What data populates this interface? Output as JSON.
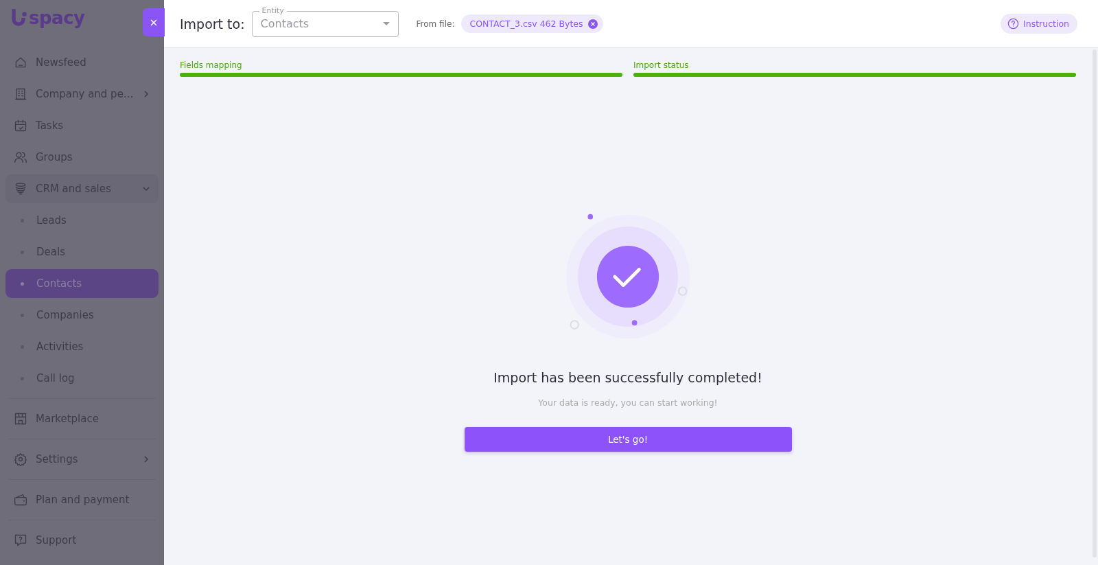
{
  "sidebar": {
    "logo": "spacy",
    "items": [
      {
        "kind": "item",
        "label": "Newsfeed",
        "submenu": false,
        "selected": false
      },
      {
        "kind": "item",
        "label": "Company and pe...",
        "submenu": true,
        "selected": false
      },
      {
        "kind": "item",
        "label": "Tasks",
        "submenu": false,
        "selected": false
      },
      {
        "kind": "item",
        "label": "Groups",
        "submenu": false,
        "selected": false
      },
      {
        "kind": "group",
        "label": "CRM and sales",
        "expanded": true,
        "selected": false,
        "children": [
          {
            "label": "Leads",
            "selected": false
          },
          {
            "label": "Deals",
            "selected": false
          },
          {
            "label": "Contacts",
            "selected": true
          },
          {
            "label": "Companies",
            "selected": false
          },
          {
            "label": "Activities",
            "selected": false
          },
          {
            "label": "Call log",
            "selected": false
          }
        ]
      },
      {
        "kind": "divider"
      },
      {
        "kind": "item",
        "label": "Marketplace",
        "submenu": false,
        "selected": false
      },
      {
        "kind": "divider"
      },
      {
        "kind": "item",
        "label": "Settings",
        "submenu": true,
        "selected": false
      },
      {
        "kind": "divider"
      },
      {
        "kind": "item",
        "label": "Plan and payment",
        "submenu": false,
        "selected": false
      },
      {
        "kind": "divider"
      },
      {
        "kind": "item",
        "label": "Support",
        "submenu": false,
        "selected": false
      }
    ]
  },
  "header": {
    "title": "Import to:",
    "entity": {
      "label": "Entity",
      "value": "Contacts"
    },
    "from_label": "From file:",
    "file": "CONTACT_3.csv 462 Bytes",
    "instruction": "Instruction"
  },
  "steps": [
    {
      "label": "Fields mapping",
      "level": 1
    },
    {
      "label": "Import status",
      "level": 1
    }
  ],
  "result": {
    "title": "Import has been successfully completed!",
    "subtitle": "Your data is ready, you can start working!",
    "button": "Let's go!"
  }
}
